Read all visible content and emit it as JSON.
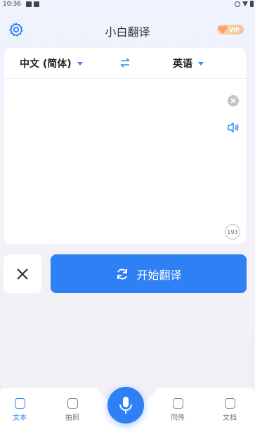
{
  "status": {
    "time": "10:36"
  },
  "header": {
    "title": "小白翻译",
    "vip_label": "VIP"
  },
  "languages": {
    "source": "中文 (简体)",
    "target": "英语"
  },
  "input": {
    "value": "",
    "char_counter": "193"
  },
  "actions": {
    "translate_label": "开始翻译"
  },
  "tabs": [
    {
      "label": "文本",
      "icon": "text-icon",
      "active": true
    },
    {
      "label": "拍照",
      "icon": "camera-icon",
      "active": false
    },
    {
      "label": "同传",
      "icon": "chat-icon",
      "active": false
    },
    {
      "label": "文档",
      "icon": "document-icon",
      "active": false
    }
  ],
  "colors": {
    "accent": "#2f80f5",
    "vip": "#f5c39a"
  }
}
